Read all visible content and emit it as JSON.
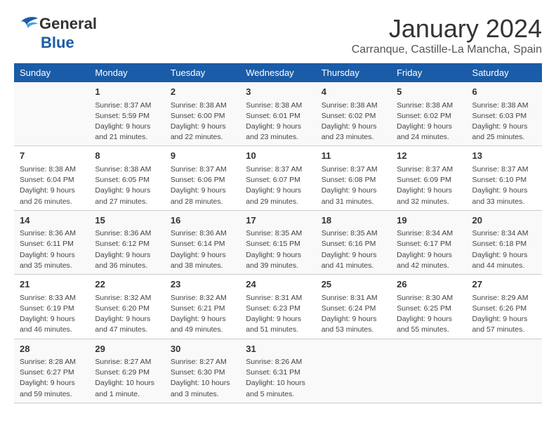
{
  "header": {
    "logo_general": "General",
    "logo_blue": "Blue",
    "month_title": "January 2024",
    "location": "Carranque, Castille-La Mancha, Spain"
  },
  "weekdays": [
    "Sunday",
    "Monday",
    "Tuesday",
    "Wednesday",
    "Thursday",
    "Friday",
    "Saturday"
  ],
  "weeks": [
    [
      {
        "day": "",
        "sunrise": "",
        "sunset": "",
        "daylight": ""
      },
      {
        "day": "1",
        "sunrise": "Sunrise: 8:37 AM",
        "sunset": "Sunset: 5:59 PM",
        "daylight": "Daylight: 9 hours and 21 minutes."
      },
      {
        "day": "2",
        "sunrise": "Sunrise: 8:38 AM",
        "sunset": "Sunset: 6:00 PM",
        "daylight": "Daylight: 9 hours and 22 minutes."
      },
      {
        "day": "3",
        "sunrise": "Sunrise: 8:38 AM",
        "sunset": "Sunset: 6:01 PM",
        "daylight": "Daylight: 9 hours and 23 minutes."
      },
      {
        "day": "4",
        "sunrise": "Sunrise: 8:38 AM",
        "sunset": "Sunset: 6:02 PM",
        "daylight": "Daylight: 9 hours and 23 minutes."
      },
      {
        "day": "5",
        "sunrise": "Sunrise: 8:38 AM",
        "sunset": "Sunset: 6:02 PM",
        "daylight": "Daylight: 9 hours and 24 minutes."
      },
      {
        "day": "6",
        "sunrise": "Sunrise: 8:38 AM",
        "sunset": "Sunset: 6:03 PM",
        "daylight": "Daylight: 9 hours and 25 minutes."
      }
    ],
    [
      {
        "day": "7",
        "sunrise": "Sunrise: 8:38 AM",
        "sunset": "Sunset: 6:04 PM",
        "daylight": "Daylight: 9 hours and 26 minutes."
      },
      {
        "day": "8",
        "sunrise": "Sunrise: 8:38 AM",
        "sunset": "Sunset: 6:05 PM",
        "daylight": "Daylight: 9 hours and 27 minutes."
      },
      {
        "day": "9",
        "sunrise": "Sunrise: 8:37 AM",
        "sunset": "Sunset: 6:06 PM",
        "daylight": "Daylight: 9 hours and 28 minutes."
      },
      {
        "day": "10",
        "sunrise": "Sunrise: 8:37 AM",
        "sunset": "Sunset: 6:07 PM",
        "daylight": "Daylight: 9 hours and 29 minutes."
      },
      {
        "day": "11",
        "sunrise": "Sunrise: 8:37 AM",
        "sunset": "Sunset: 6:08 PM",
        "daylight": "Daylight: 9 hours and 31 minutes."
      },
      {
        "day": "12",
        "sunrise": "Sunrise: 8:37 AM",
        "sunset": "Sunset: 6:09 PM",
        "daylight": "Daylight: 9 hours and 32 minutes."
      },
      {
        "day": "13",
        "sunrise": "Sunrise: 8:37 AM",
        "sunset": "Sunset: 6:10 PM",
        "daylight": "Daylight: 9 hours and 33 minutes."
      }
    ],
    [
      {
        "day": "14",
        "sunrise": "Sunrise: 8:36 AM",
        "sunset": "Sunset: 6:11 PM",
        "daylight": "Daylight: 9 hours and 35 minutes."
      },
      {
        "day": "15",
        "sunrise": "Sunrise: 8:36 AM",
        "sunset": "Sunset: 6:12 PM",
        "daylight": "Daylight: 9 hours and 36 minutes."
      },
      {
        "day": "16",
        "sunrise": "Sunrise: 8:36 AM",
        "sunset": "Sunset: 6:14 PM",
        "daylight": "Daylight: 9 hours and 38 minutes."
      },
      {
        "day": "17",
        "sunrise": "Sunrise: 8:35 AM",
        "sunset": "Sunset: 6:15 PM",
        "daylight": "Daylight: 9 hours and 39 minutes."
      },
      {
        "day": "18",
        "sunrise": "Sunrise: 8:35 AM",
        "sunset": "Sunset: 6:16 PM",
        "daylight": "Daylight: 9 hours and 41 minutes."
      },
      {
        "day": "19",
        "sunrise": "Sunrise: 8:34 AM",
        "sunset": "Sunset: 6:17 PM",
        "daylight": "Daylight: 9 hours and 42 minutes."
      },
      {
        "day": "20",
        "sunrise": "Sunrise: 8:34 AM",
        "sunset": "Sunset: 6:18 PM",
        "daylight": "Daylight: 9 hours and 44 minutes."
      }
    ],
    [
      {
        "day": "21",
        "sunrise": "Sunrise: 8:33 AM",
        "sunset": "Sunset: 6:19 PM",
        "daylight": "Daylight: 9 hours and 46 minutes."
      },
      {
        "day": "22",
        "sunrise": "Sunrise: 8:32 AM",
        "sunset": "Sunset: 6:20 PM",
        "daylight": "Daylight: 9 hours and 47 minutes."
      },
      {
        "day": "23",
        "sunrise": "Sunrise: 8:32 AM",
        "sunset": "Sunset: 6:21 PM",
        "daylight": "Daylight: 9 hours and 49 minutes."
      },
      {
        "day": "24",
        "sunrise": "Sunrise: 8:31 AM",
        "sunset": "Sunset: 6:23 PM",
        "daylight": "Daylight: 9 hours and 51 minutes."
      },
      {
        "day": "25",
        "sunrise": "Sunrise: 8:31 AM",
        "sunset": "Sunset: 6:24 PM",
        "daylight": "Daylight: 9 hours and 53 minutes."
      },
      {
        "day": "26",
        "sunrise": "Sunrise: 8:30 AM",
        "sunset": "Sunset: 6:25 PM",
        "daylight": "Daylight: 9 hours and 55 minutes."
      },
      {
        "day": "27",
        "sunrise": "Sunrise: 8:29 AM",
        "sunset": "Sunset: 6:26 PM",
        "daylight": "Daylight: 9 hours and 57 minutes."
      }
    ],
    [
      {
        "day": "28",
        "sunrise": "Sunrise: 8:28 AM",
        "sunset": "Sunset: 6:27 PM",
        "daylight": "Daylight: 9 hours and 59 minutes."
      },
      {
        "day": "29",
        "sunrise": "Sunrise: 8:27 AM",
        "sunset": "Sunset: 6:29 PM",
        "daylight": "Daylight: 10 hours and 1 minute."
      },
      {
        "day": "30",
        "sunrise": "Sunrise: 8:27 AM",
        "sunset": "Sunset: 6:30 PM",
        "daylight": "Daylight: 10 hours and 3 minutes."
      },
      {
        "day": "31",
        "sunrise": "Sunrise: 8:26 AM",
        "sunset": "Sunset: 6:31 PM",
        "daylight": "Daylight: 10 hours and 5 minutes."
      },
      {
        "day": "",
        "sunrise": "",
        "sunset": "",
        "daylight": ""
      },
      {
        "day": "",
        "sunrise": "",
        "sunset": "",
        "daylight": ""
      },
      {
        "day": "",
        "sunrise": "",
        "sunset": "",
        "daylight": ""
      }
    ]
  ]
}
